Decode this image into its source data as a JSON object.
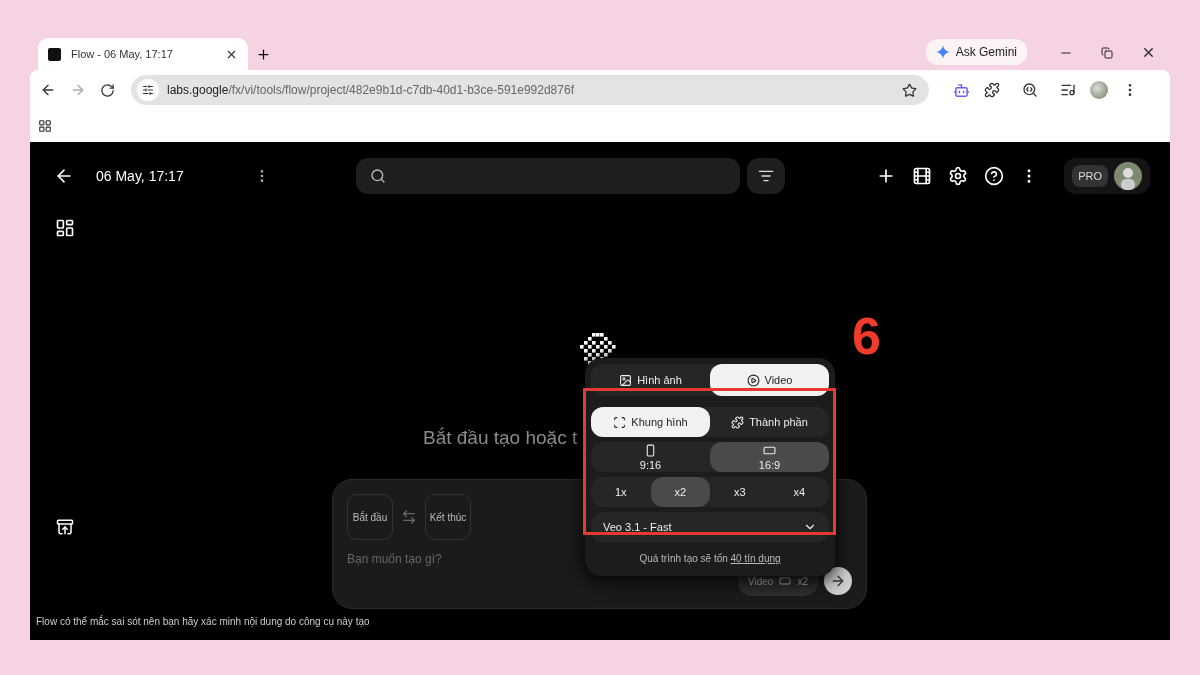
{
  "browser": {
    "tab": {
      "title": "Flow - 06 May, 17:17",
      "selected": true
    },
    "gemini_button": "Ask Gemini",
    "url": {
      "host": "labs.google",
      "path": "/fx/vi/tools/flow/project/482e9b1d-c7db-40d1-b3ce-591e992d876f"
    },
    "forward_disabled": true
  },
  "app": {
    "project_title": "06 May, 17:17",
    "plan_badge": "PRO",
    "headline": "Bắt đầu tạo hoặc t",
    "prompt": {
      "frames": [
        {
          "label": "Bắt đầu"
        },
        {
          "label": "Kết thúc"
        }
      ],
      "placeholder": "Bạn muốn tạo gì?",
      "chip_mode": "Video",
      "chip_count": "x2"
    },
    "footer": "Flow có thể mắc sai sót nên bạn hãy xác minh nội dung do công cụ này tạo"
  },
  "popup": {
    "media_tabs": [
      {
        "label": "Hình ảnh",
        "kind": "image",
        "selected": false
      },
      {
        "label": "Video",
        "kind": "video",
        "selected": true
      }
    ],
    "input_modes": [
      {
        "label": "Khung hình",
        "kind": "frame",
        "selected": true
      },
      {
        "label": "Thành phần",
        "kind": "ingredients",
        "selected": false
      }
    ],
    "aspect_ratios": [
      {
        "label": "9:16",
        "kind": "portrait",
        "selected": false
      },
      {
        "label": "16:9",
        "kind": "landscape",
        "selected": true
      }
    ],
    "counts": [
      {
        "label": "1x",
        "selected": false
      },
      {
        "label": "x2",
        "selected": true
      },
      {
        "label": "x3",
        "selected": false
      },
      {
        "label": "x4",
        "selected": false
      }
    ],
    "model": "Veo 3.1 - Fast",
    "cost_text": "Quá trình tạo sẽ tốn",
    "cost_link": "40 tín dụng"
  },
  "annotation": {
    "label": "6"
  }
}
